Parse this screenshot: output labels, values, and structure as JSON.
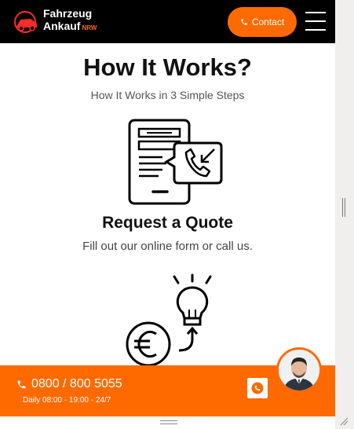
{
  "header": {
    "logo_line1": "Fahrzeug",
    "logo_line2": "Ankauf",
    "logo_suffix": "NRW",
    "contact_label": "Contact"
  },
  "section": {
    "title": "How It Works?",
    "subtitle": "How It Works in 3 Simple Steps"
  },
  "steps": [
    {
      "title": "Request a Quote",
      "description": "Fill out our online form or call us."
    }
  ],
  "bottom_bar": {
    "phone": "0800 / 800 5055",
    "hours": "Daily 08:00 - 19:00 - 24/7"
  },
  "colors": {
    "accent": "#ff6a00",
    "header_bg": "#000000",
    "text": "#111111"
  },
  "icons": [
    "car-logo-icon",
    "phone-icon",
    "menu-icon",
    "phone-quote-icon",
    "lightbulb-euro-icon",
    "whatsapp-icon",
    "agent-avatar"
  ]
}
